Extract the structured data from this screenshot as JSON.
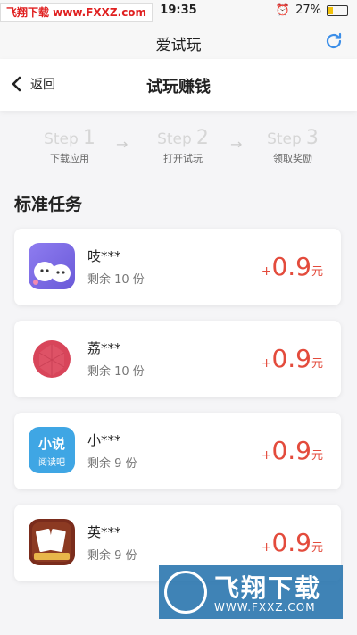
{
  "status": {
    "watermark": "飞翔下载 www.FXXZ.com",
    "time": "19:35",
    "battery": "27%",
    "battery_level": 0.27
  },
  "topbar": {
    "title": "爱试玩",
    "refresh_icon": "refresh-icon"
  },
  "navbar": {
    "back_label": "返回",
    "title": "试玩赚钱"
  },
  "steps": [
    {
      "step_word": "Step",
      "num": "1",
      "label": "下载应用"
    },
    {
      "step_word": "Step",
      "num": "2",
      "label": "打开试玩"
    },
    {
      "step_word": "Step",
      "num": "3",
      "label": "领取奖励"
    }
  ],
  "section_title": "标准任务",
  "tasks": [
    {
      "name": "吱***",
      "remain": "剩余 10 份",
      "plus": "+",
      "amount": "0.9",
      "unit": "元",
      "icon": "cartoon-app-icon"
    },
    {
      "name": "荔***",
      "remain": "剩余 10 份",
      "plus": "+",
      "amount": "0.9",
      "unit": "元",
      "icon": "lychee-icon"
    },
    {
      "name": "小***",
      "remain": "剩余 9 份",
      "plus": "+",
      "amount": "0.9",
      "unit": "元",
      "icon": "novel-reader-icon",
      "icon_text1": "小说",
      "icon_text2": "阅读吧"
    },
    {
      "name": "英***",
      "remain": "剩余 9 份",
      "plus": "+",
      "amount": "0.9",
      "unit": "元",
      "icon": "poker-game-icon"
    }
  ],
  "watermark_logo": {
    "title": "飞翔下载",
    "url": "WWW.FXXZ.COM"
  },
  "colors": {
    "accent": "#e34b3c",
    "refresh": "#3b8ee8"
  }
}
